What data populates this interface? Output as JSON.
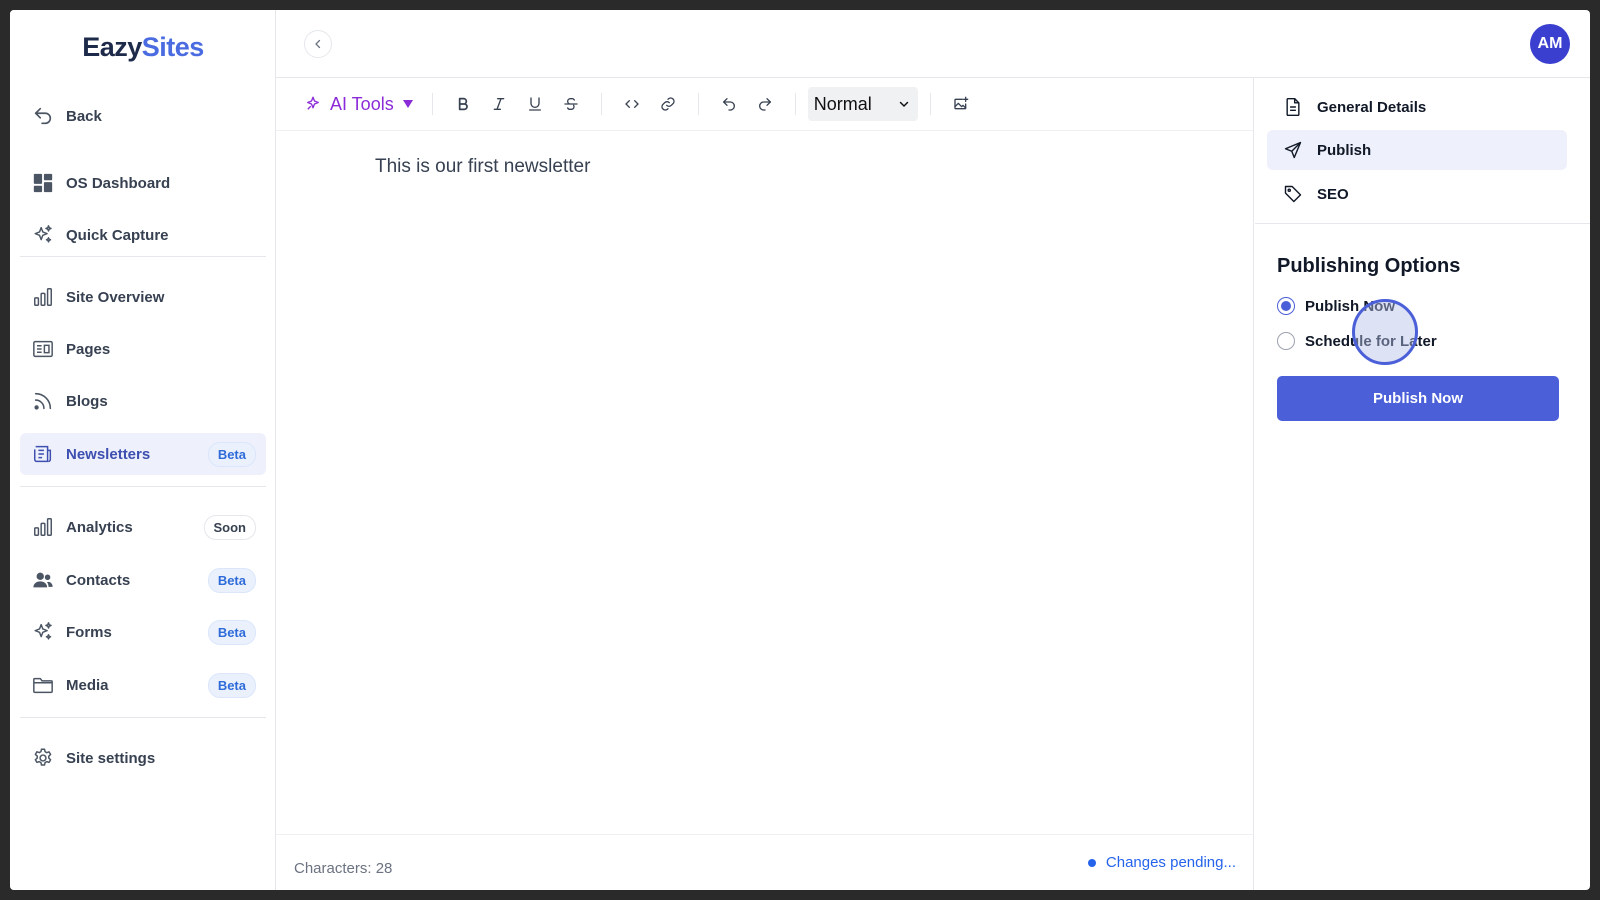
{
  "app": {
    "logo_part1": "Eazy",
    "logo_part2": "Sites"
  },
  "sidebar": {
    "back_label": "Back",
    "items": [
      {
        "label": "OS Dashboard",
        "icon": "dashboard-icon"
      },
      {
        "label": "Quick Capture",
        "icon": "sparkles-icon"
      },
      {
        "label": "Site Overview",
        "icon": "bar-chart-icon"
      },
      {
        "label": "Pages",
        "icon": "pages-icon"
      },
      {
        "label": "Blogs",
        "icon": "rss-icon"
      },
      {
        "label": "Newsletters",
        "icon": "newspaper-icon",
        "badge": "Beta",
        "active": true
      },
      {
        "label": "Analytics",
        "icon": "bar-chart-icon",
        "badge": "Soon"
      },
      {
        "label": "Contacts",
        "icon": "users-icon",
        "badge": "Beta"
      },
      {
        "label": "Forms",
        "icon": "sparkles-icon",
        "badge": "Beta"
      },
      {
        "label": "Media",
        "icon": "folder-icon",
        "badge": "Beta"
      },
      {
        "label": "Site settings",
        "icon": "gear-icon"
      }
    ]
  },
  "header": {
    "avatar_initials": "AM"
  },
  "toolbar": {
    "ai_tools_label": "AI Tools",
    "text_style": "Normal",
    "buttons": [
      "bold-icon",
      "italic-icon",
      "underline-icon",
      "strikethrough-icon",
      "code-icon",
      "link-icon",
      "undo-icon",
      "redo-icon",
      "insert-image-icon"
    ]
  },
  "editor": {
    "content": "This is our first newsletter",
    "char_count": "Characters: 28",
    "status": "Changes pending..."
  },
  "right_panel": {
    "tabs": [
      {
        "label": "General Details",
        "icon": "document-icon"
      },
      {
        "label": "Publish",
        "icon": "send-icon",
        "active": true
      },
      {
        "label": "SEO",
        "icon": "tag-icon"
      }
    ],
    "title": "Publishing Options",
    "options": [
      {
        "label": "Publish Now",
        "checked": true
      },
      {
        "label": "Schedule for Later",
        "checked": false
      }
    ],
    "primary_button": "Publish Now"
  },
  "colors": {
    "accent": "#4a5fd8",
    "ai": "#8b2bd8",
    "avatar": "#3b3fcf",
    "active_bg": "#eef0fb"
  }
}
